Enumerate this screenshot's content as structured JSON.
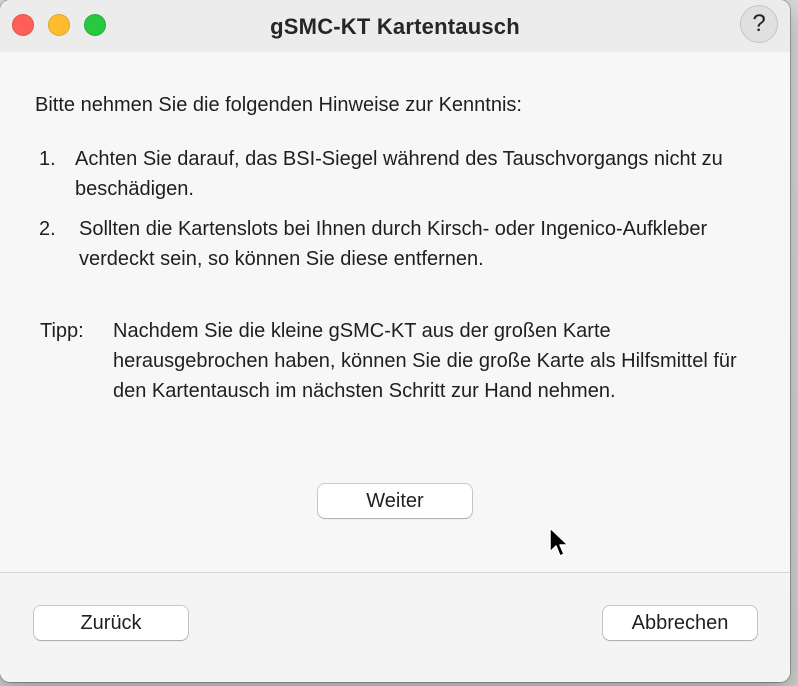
{
  "window": {
    "title": "gSMC-KT Kartentausch",
    "help_label": "?"
  },
  "colors": {
    "close": "#fe5f57",
    "minimize": "#febc2e",
    "zoom": "#28c840"
  },
  "content": {
    "intro": "Bitte nehmen Sie die folgenden Hinweise zur Kenntnis:",
    "items": [
      {
        "number": "1.",
        "text": "Achten Sie darauf, das BSI-Siegel während des Tauschvorgangs nicht zu beschädigen."
      },
      {
        "number": "2.",
        "text": "Sollten die Kartenslots bei Ihnen durch Kirsch- oder Ingenico-Aufkleber verdeckt sein, so können Sie diese entfernen."
      }
    ],
    "tip_label": "Tipp:",
    "tip_text": "Nachdem Sie die kleine gSMC-KT aus der großen Karte herausgebrochen haben, können Sie die große Karte als Hilfsmittel für den Kartentausch im nächsten Schritt zur Hand nehmen.",
    "next_label": "Weiter"
  },
  "footer": {
    "back_label": "Zurück",
    "cancel_label": "Abbrechen"
  },
  "icons": {
    "cursor": "arrow-cursor-icon"
  }
}
